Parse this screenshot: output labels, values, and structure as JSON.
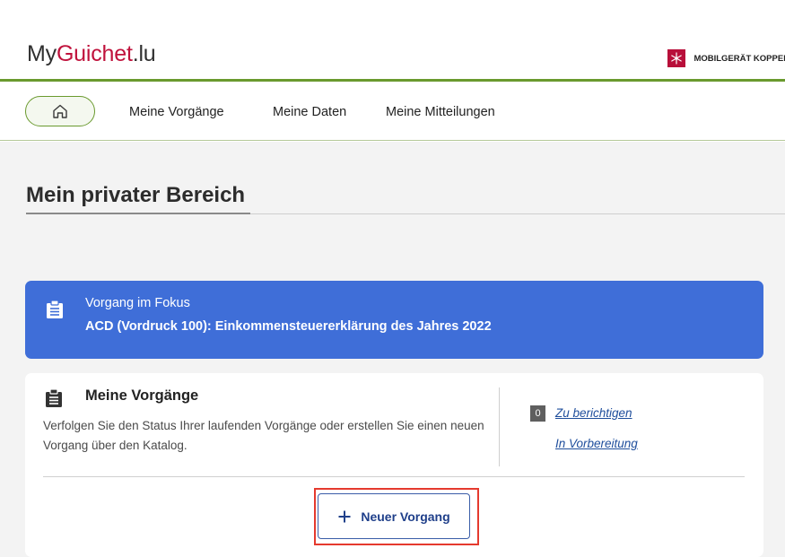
{
  "header": {
    "logo_prefix": "My",
    "logo_brand": "Guichet",
    "logo_suffix": ".lu",
    "device_link": "MOBILGERÄT KOPPEL",
    "device_icon": "snowflake-icon",
    "accent_color": "#b80f3a"
  },
  "nav": {
    "home_icon": "home-icon",
    "items": [
      {
        "label": "Meine Vorgänge"
      },
      {
        "label": "Meine Daten"
      },
      {
        "label": "Meine Mitteilungen"
      }
    ],
    "accent_color": "#6a9a2e"
  },
  "page": {
    "title": "Mein privater Bereich"
  },
  "focus": {
    "icon": "clipboard-icon",
    "heading": "Vorgang im Fokus",
    "title": "ACD (Vordruck 100): Einkommensteuererklärung des Jahres 2022",
    "color": "#3f6ed8"
  },
  "procedures": {
    "icon": "clipboard-icon",
    "title": "Meine Vorgänge",
    "description": "Verfolgen Sie den Status Ihrer laufenden Vorgänge oder erstellen Sie einen neuen Vorgang über den Katalog.",
    "count": "0",
    "link_correct": "Zu berichtigen",
    "link_preparation": "In Vorbereitung",
    "new_button": "Neuer Vorgang",
    "new_button_icon": "plus-icon"
  }
}
